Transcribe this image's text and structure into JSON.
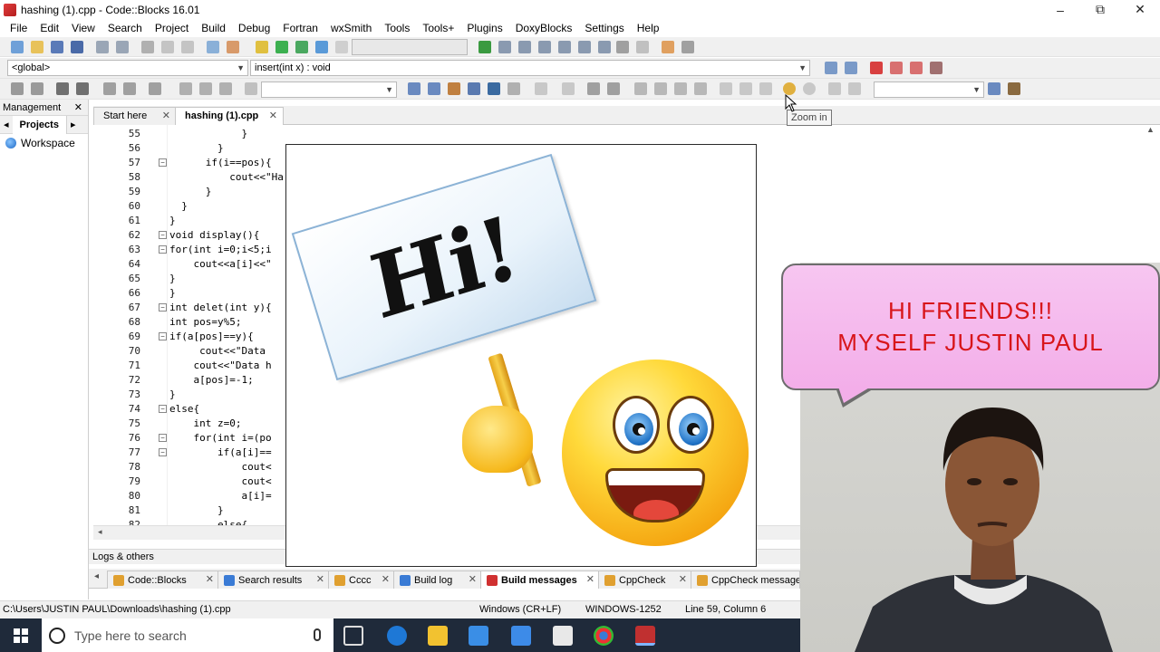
{
  "window": {
    "title": "hashing (1).cpp - Code::Blocks 16.01",
    "minimize": "–",
    "maximize": "⧉",
    "close": "✕"
  },
  "menu": [
    "File",
    "Edit",
    "View",
    "Search",
    "Project",
    "Build",
    "Debug",
    "Fortran",
    "wxSmith",
    "Tools",
    "Tools+",
    "Plugins",
    "DoxyBlocks",
    "Settings",
    "Help"
  ],
  "scope": {
    "left": "<global>",
    "right": "insert(int x) : void"
  },
  "tooltip": "Zoom in",
  "management": {
    "title": "Management",
    "tab": "Projects",
    "workspace": "Workspace"
  },
  "editor_tabs": [
    {
      "label": "Start here"
    },
    {
      "label": "hashing (1).cpp",
      "active": true
    }
  ],
  "code": [
    {
      "n": "55",
      "t": "            }"
    },
    {
      "n": "56",
      "t": "        }"
    },
    {
      "n": "57",
      "t": "      if(i==pos){"
    },
    {
      "n": "58",
      "t": "          cout<<\"Ha"
    },
    {
      "n": "59",
      "t": "      }"
    },
    {
      "n": "60",
      "t": "  }"
    },
    {
      "n": "61",
      "t": "}"
    },
    {
      "n": "62",
      "t": "void display(){"
    },
    {
      "n": "63",
      "t": "for(int i=0;i<5;i"
    },
    {
      "n": "64",
      "t": "    cout<<a[i]<<\""
    },
    {
      "n": "65",
      "t": "}"
    },
    {
      "n": "66",
      "t": "}"
    },
    {
      "n": "67",
      "t": "int delet(int y){"
    },
    {
      "n": "68",
      "t": "int pos=y%5;"
    },
    {
      "n": "69",
      "t": "if(a[pos]==y){"
    },
    {
      "n": "70",
      "t": "     cout<<\"Data"
    },
    {
      "n": "71",
      "t": "    cout<<\"Data h"
    },
    {
      "n": "72",
      "t": "    a[pos]=-1;"
    },
    {
      "n": "73",
      "t": "}"
    },
    {
      "n": "74",
      "t": "else{"
    },
    {
      "n": "75",
      "t": "    int z=0;"
    },
    {
      "n": "76",
      "t": "    for(int i=(po"
    },
    {
      "n": "77",
      "t": "        if(a[i]=="
    },
    {
      "n": "78",
      "t": "            cout<"
    },
    {
      "n": "79",
      "t": "            cout<"
    },
    {
      "n": "80",
      "t": "            a[i]="
    },
    {
      "n": "81",
      "t": "        }"
    },
    {
      "n": "82",
      "t": "        else{"
    }
  ],
  "overlay": {
    "sign_text": "Hi!"
  },
  "bubble": {
    "line1": "HI FRIENDS!!!",
    "line2": "MYSELF JUSTIN PAUL"
  },
  "logs": {
    "title": "Logs & others",
    "tabs": [
      {
        "label": "Code::Blocks",
        "color": "#e0a030"
      },
      {
        "label": "Search results",
        "color": "#3a7bd5"
      },
      {
        "label": "Cccc",
        "color": "#e0a030"
      },
      {
        "label": "Build log",
        "color": "#3a7bd5"
      },
      {
        "label": "Build messages",
        "color": "#d03030",
        "active": true
      },
      {
        "label": "CppCheck",
        "color": "#e0a030"
      },
      {
        "label": "CppCheck messages",
        "color": "#e0a030"
      }
    ]
  },
  "status": {
    "path": "C:\\Users\\JUSTIN PAUL\\Downloads\\hashing (1).cpp",
    "eol": "Windows (CR+LF)",
    "encoding": "WINDOWS-1252",
    "position": "Line 59, Column 6"
  },
  "taskbar": {
    "search_placeholder": "Type here to search"
  }
}
